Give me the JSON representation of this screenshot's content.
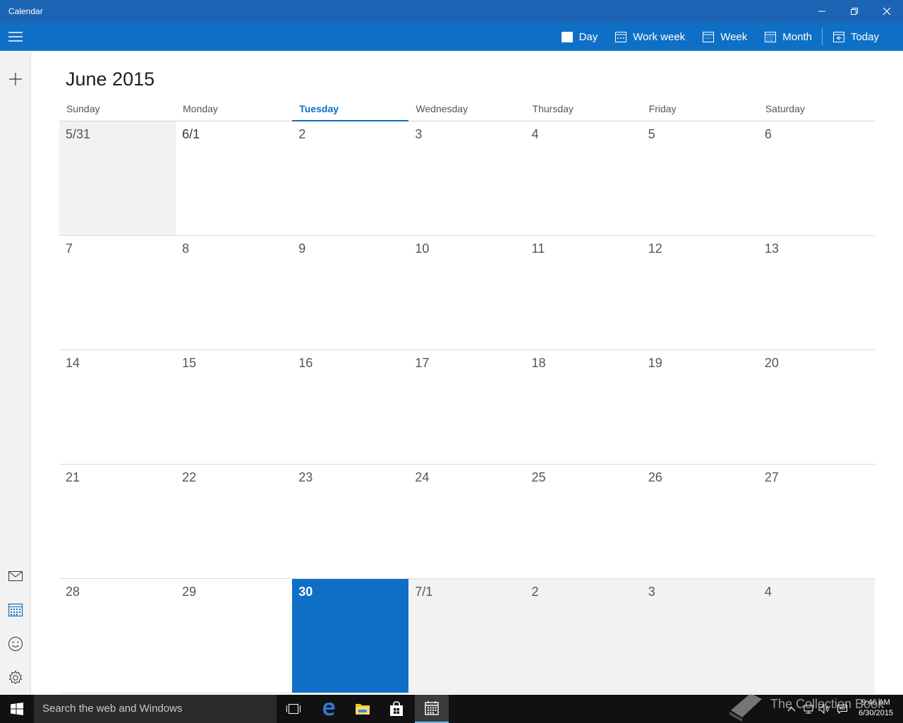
{
  "window": {
    "title": "Calendar"
  },
  "commandbar": {
    "views": [
      {
        "label": "Day",
        "icon": "day-view-icon"
      },
      {
        "label": "Work week",
        "icon": "work-week-view-icon"
      },
      {
        "label": "Week",
        "icon": "week-view-icon"
      },
      {
        "label": "Month",
        "icon": "month-view-icon"
      },
      {
        "label": "Today",
        "icon": "today-icon"
      }
    ]
  },
  "calendar": {
    "month_title": "June 2015",
    "weekdays": [
      "Sunday",
      "Monday",
      "Tuesday",
      "Wednesday",
      "Thursday",
      "Friday",
      "Saturday"
    ],
    "today_weekday_index": 2,
    "weeks": [
      [
        "5/31",
        "6/1",
        "2",
        "3",
        "4",
        "5",
        "6"
      ],
      [
        "7",
        "8",
        "9",
        "10",
        "11",
        "12",
        "13"
      ],
      [
        "14",
        "15",
        "16",
        "17",
        "18",
        "19",
        "20"
      ],
      [
        "21",
        "22",
        "23",
        "24",
        "25",
        "26",
        "27"
      ],
      [
        "28",
        "29",
        "30",
        "7/1",
        "2",
        "3",
        "4"
      ]
    ],
    "accent_color": "#0f6fc6"
  },
  "taskbar": {
    "search_placeholder": "Search the web and Windows",
    "time": "9:46 AM",
    "date": "6/30/2015",
    "watermark": "The Collection Book"
  }
}
